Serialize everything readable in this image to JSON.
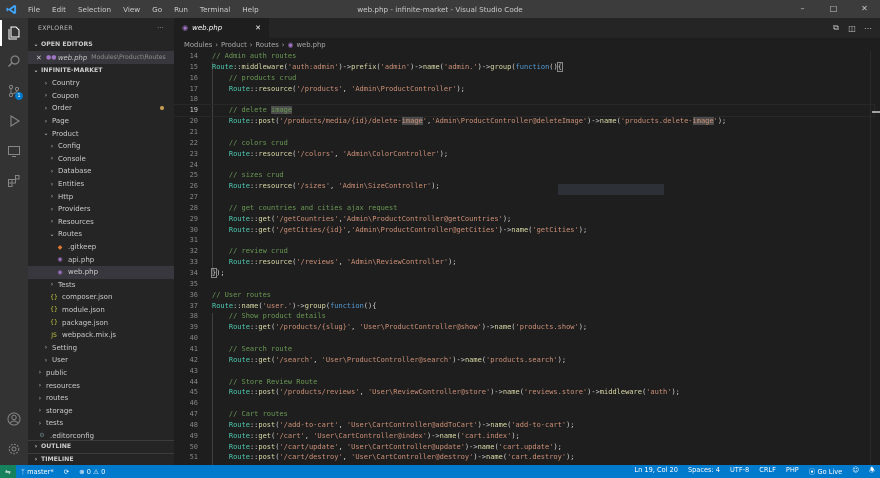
{
  "titlebar": {
    "menu": [
      "File",
      "Edit",
      "Selection",
      "View",
      "Go",
      "Run",
      "Terminal",
      "Help"
    ],
    "title": "web.php - infinite-market - Visual Studio Code"
  },
  "sidebar": {
    "header": "EXPLORER",
    "more": "···",
    "open_editors_label": "OPEN EDITORS",
    "open_editor": {
      "name": "web.php",
      "path": "Modules\\Product\\Routes"
    },
    "project_label": "INFINITE-MARKET",
    "tree": [
      {
        "label": "Country",
        "depth": 1,
        "kind": "folder",
        "open": false
      },
      {
        "label": "Coupon",
        "depth": 1,
        "kind": "folder",
        "open": false
      },
      {
        "label": "Order",
        "depth": 1,
        "kind": "folder",
        "open": false,
        "modified": true
      },
      {
        "label": "Page",
        "depth": 1,
        "kind": "folder",
        "open": false
      },
      {
        "label": "Product",
        "depth": 1,
        "kind": "folder",
        "open": true
      },
      {
        "label": "Config",
        "depth": 2,
        "kind": "folder",
        "open": false
      },
      {
        "label": "Console",
        "depth": 2,
        "kind": "folder",
        "open": false
      },
      {
        "label": "Database",
        "depth": 2,
        "kind": "folder",
        "open": false
      },
      {
        "label": "Entities",
        "depth": 2,
        "kind": "folder",
        "open": false
      },
      {
        "label": "Http",
        "depth": 2,
        "kind": "folder",
        "open": false
      },
      {
        "label": "Providers",
        "depth": 2,
        "kind": "folder",
        "open": false
      },
      {
        "label": "Resources",
        "depth": 2,
        "kind": "folder",
        "open": false
      },
      {
        "label": "Routes",
        "depth": 2,
        "kind": "folder",
        "open": true
      },
      {
        "label": ".gitkeep",
        "depth": 3,
        "kind": "file",
        "icon": "git"
      },
      {
        "label": "api.php",
        "depth": 3,
        "kind": "file",
        "icon": "php"
      },
      {
        "label": "web.php",
        "depth": 3,
        "kind": "file",
        "icon": "php",
        "selected": true
      },
      {
        "label": "Tests",
        "depth": 2,
        "kind": "folder",
        "open": false
      },
      {
        "label": "composer.json",
        "depth": 2,
        "kind": "file",
        "icon": "json"
      },
      {
        "label": "module.json",
        "depth": 2,
        "kind": "file",
        "icon": "json"
      },
      {
        "label": "package.json",
        "depth": 2,
        "kind": "file",
        "icon": "json"
      },
      {
        "label": "webpack.mix.js",
        "depth": 2,
        "kind": "file",
        "icon": "js"
      },
      {
        "label": "Setting",
        "depth": 1,
        "kind": "folder",
        "open": false
      },
      {
        "label": "User",
        "depth": 1,
        "kind": "folder",
        "open": false
      },
      {
        "label": "public",
        "depth": 0,
        "kind": "folder",
        "open": false
      },
      {
        "label": "resources",
        "depth": 0,
        "kind": "folder",
        "open": false
      },
      {
        "label": "routes",
        "depth": 0,
        "kind": "folder",
        "open": false
      },
      {
        "label": "storage",
        "depth": 0,
        "kind": "folder",
        "open": false
      },
      {
        "label": "tests",
        "depth": 0,
        "kind": "folder",
        "open": false
      },
      {
        "label": ".editorconfig",
        "depth": 0,
        "kind": "file",
        "icon": "gear"
      }
    ],
    "outline_label": "OUTLINE",
    "timeline_label": "TIMELINE"
  },
  "editor": {
    "tab_label": "web.php",
    "breadcrumb": [
      "Modules",
      "Product",
      "Routes",
      "web.php"
    ],
    "current_line": 19,
    "lines": [
      {
        "n": 14,
        "html": "<span class=\"c\">// Admin auth routes</span>"
      },
      {
        "n": 15,
        "html": "<span class=\"t\">Route</span><span class=\"p\">::</span><span class=\"f\">middleware</span><span class=\"p\">(</span><span class=\"s\">'auth:admin'</span><span class=\"p\">)-&gt;</span><span class=\"f\">prefix</span><span class=\"p\">(</span><span class=\"s\">'admin'</span><span class=\"p\">)-&gt;</span><span class=\"f\">name</span><span class=\"p\">(</span><span class=\"s\">'admin.'</span><span class=\"p\">)-&gt;</span><span class=\"f\">group</span><span class=\"p\">(</span><span class=\"k\">function</span><span class=\"p\">()</span><span class=\"p hlb\">{</span>"
      },
      {
        "n": 16,
        "html": "    <span class=\"c\">// products crud</span>"
      },
      {
        "n": 17,
        "html": "    <span class=\"t\">Route</span><span class=\"p\">::</span><span class=\"f\">resource</span><span class=\"p\">(</span><span class=\"s\">'/products'</span><span class=\"p\">, </span><span class=\"s\">'Admin\\ProductController'</span><span class=\"p\">);</span>"
      },
      {
        "n": 18,
        "html": ""
      },
      {
        "n": 19,
        "html": "    <span class=\"c\">// delete <span class=\"hl\">image</span></span>"
      },
      {
        "n": 20,
        "html": "    <span class=\"t\">Route</span><span class=\"p\">::</span><span class=\"f\">post</span><span class=\"p\">(</span><span class=\"s\">'/products/media/{id}/delete-<span class=\"hl\">image</span>'</span><span class=\"p\">,</span><span class=\"s\">'Admin\\ProductController@deleteImage'</span><span class=\"p\">)-&gt;</span><span class=\"f\">name</span><span class=\"p\">(</span><span class=\"s\">'products.delete-<span class=\"hl\">image</span>'</span><span class=\"p\">);</span>"
      },
      {
        "n": 21,
        "html": ""
      },
      {
        "n": 22,
        "html": "    <span class=\"c\">// colors crud</span>"
      },
      {
        "n": 23,
        "html": "    <span class=\"t\">Route</span><span class=\"p\">::</span><span class=\"f\">resource</span><span class=\"p\">(</span><span class=\"s\">'/colors'</span><span class=\"p\">, </span><span class=\"s\">'Admin\\ColorController'</span><span class=\"p\">);</span>"
      },
      {
        "n": 24,
        "html": ""
      },
      {
        "n": 25,
        "html": "    <span class=\"c\">// sizes crud</span>"
      },
      {
        "n": 26,
        "html": "    <span class=\"t\">Route</span><span class=\"p\">::</span><span class=\"f\">resource</span><span class=\"p\">(</span><span class=\"s\">'/sizes'</span><span class=\"p\">, </span><span class=\"s\">'Admin\\SizeController'</span><span class=\"p\">);</span>"
      },
      {
        "n": 27,
        "html": ""
      },
      {
        "n": 28,
        "html": "    <span class=\"c\">// get countries and cities ajax request</span>"
      },
      {
        "n": 29,
        "html": "    <span class=\"t\">Route</span><span class=\"p\">::</span><span class=\"f\">get</span><span class=\"p\">(</span><span class=\"s\">'/getCountries'</span><span class=\"p\">,</span><span class=\"s\">'Admin\\ProductController@getCountries'</span><span class=\"p\">);</span>"
      },
      {
        "n": 30,
        "html": "    <span class=\"t\">Route</span><span class=\"p\">::</span><span class=\"f\">get</span><span class=\"p\">(</span><span class=\"s\">'/getCities/{id}'</span><span class=\"p\">,</span><span class=\"s\">'Admin\\ProductController@getCities'</span><span class=\"p\">)-&gt;</span><span class=\"f\">name</span><span class=\"p\">(</span><span class=\"s\">'getCities'</span><span class=\"p\">);</span>"
      },
      {
        "n": 31,
        "html": ""
      },
      {
        "n": 32,
        "html": "    <span class=\"c\">// review crud</span>"
      },
      {
        "n": 33,
        "html": "    <span class=\"t\">Route</span><span class=\"p\">::</span><span class=\"f\">resource</span><span class=\"p\">(</span><span class=\"s\">'/reviews'</span><span class=\"p\">, </span><span class=\"s\">'Admin\\ReviewController'</span><span class=\"p\">);</span>"
      },
      {
        "n": 34,
        "html": "<span class=\"p hlb\">}</span><span class=\"p\">);</span>"
      },
      {
        "n": 35,
        "html": ""
      },
      {
        "n": 36,
        "html": "<span class=\"c\">// User routes</span>"
      },
      {
        "n": 37,
        "html": "<span class=\"t\">Route</span><span class=\"p\">::</span><span class=\"f\">name</span><span class=\"p\">(</span><span class=\"s\">'user.'</span><span class=\"p\">)-&gt;</span><span class=\"f\">group</span><span class=\"p\">(</span><span class=\"k\">function</span><span class=\"p\">(){</span>"
      },
      {
        "n": 38,
        "html": "    <span class=\"c\">// Show product details</span>"
      },
      {
        "n": 39,
        "html": "    <span class=\"t\">Route</span><span class=\"p\">::</span><span class=\"f\">get</span><span class=\"p\">(</span><span class=\"s\">'/products/{slug}'</span><span class=\"p\">, </span><span class=\"s\">'User\\ProductController@show'</span><span class=\"p\">)-&gt;</span><span class=\"f\">name</span><span class=\"p\">(</span><span class=\"s\">'products.show'</span><span class=\"p\">);</span>"
      },
      {
        "n": 40,
        "html": ""
      },
      {
        "n": 41,
        "html": "    <span class=\"c\">// Search route</span>"
      },
      {
        "n": 42,
        "html": "    <span class=\"t\">Route</span><span class=\"p\">::</span><span class=\"f\">get</span><span class=\"p\">(</span><span class=\"s\">'/search'</span><span class=\"p\">, </span><span class=\"s\">'User\\ProductController@search'</span><span class=\"p\">)-&gt;</span><span class=\"f\">name</span><span class=\"p\">(</span><span class=\"s\">'products.search'</span><span class=\"p\">);</span>"
      },
      {
        "n": 43,
        "html": ""
      },
      {
        "n": 44,
        "html": "    <span class=\"c\">// Store Review Route</span>"
      },
      {
        "n": 45,
        "html": "    <span class=\"t\">Route</span><span class=\"p\">::</span><span class=\"f\">post</span><span class=\"p\">(</span><span class=\"s\">'/products/reviews'</span><span class=\"p\">, </span><span class=\"s\">'User\\ReviewController@store'</span><span class=\"p\">)-&gt;</span><span class=\"f\">name</span><span class=\"p\">(</span><span class=\"s\">'reviews.store'</span><span class=\"p\">)-&gt;</span><span class=\"f\">middleware</span><span class=\"p\">(</span><span class=\"s\">'auth'</span><span class=\"p\">);</span>"
      },
      {
        "n": 46,
        "html": ""
      },
      {
        "n": 47,
        "html": "    <span class=\"c\">// Cart routes</span>"
      },
      {
        "n": 48,
        "html": "    <span class=\"t\">Route</span><span class=\"p\">::</span><span class=\"f\">post</span><span class=\"p\">(</span><span class=\"s\">'/add-to-cart'</span><span class=\"p\">, </span><span class=\"s\">'User\\CartController@addToCart'</span><span class=\"p\">)-&gt;</span><span class=\"f\">name</span><span class=\"p\">(</span><span class=\"s\">'add-to-cart'</span><span class=\"p\">);</span>"
      },
      {
        "n": 49,
        "html": "    <span class=\"t\">Route</span><span class=\"p\">::</span><span class=\"f\">get</span><span class=\"p\">(</span><span class=\"s\">'/cart'</span><span class=\"p\">, </span><span class=\"s\">'User\\CartController@index'</span><span class=\"p\">)-&gt;</span><span class=\"f\">name</span><span class=\"p\">(</span><span class=\"s\">'cart.index'</span><span class=\"p\">);</span>"
      },
      {
        "n": 50,
        "html": "    <span class=\"t\">Route</span><span class=\"p\">::</span><span class=\"f\">post</span><span class=\"p\">(</span><span class=\"s\">'/cart/update'</span><span class=\"p\">, </span><span class=\"s\">'User\\CartController@update'</span><span class=\"p\">)-&gt;</span><span class=\"f\">name</span><span class=\"p\">(</span><span class=\"s\">'cart.update'</span><span class=\"p\">);</span>"
      },
      {
        "n": 51,
        "html": "    <span class=\"t\">Route</span><span class=\"p\">::</span><span class=\"f\">post</span><span class=\"p\">(</span><span class=\"s\">'/cart/destroy'</span><span class=\"p\">, </span><span class=\"s\">'User\\CartController@destroy'</span><span class=\"p\">)-&gt;</span><span class=\"f\">name</span><span class=\"p\">(</span><span class=\"s\">'cart.destroy'</span><span class=\"p\">);</span>"
      }
    ]
  },
  "statusbar": {
    "branch": "master*",
    "errors": "0",
    "warnings": "0",
    "position": "Ln 19, Col 20",
    "spaces": "Spaces: 4",
    "encoding": "UTF-8",
    "eol": "CRLF",
    "language": "PHP",
    "golive": "Go Live"
  },
  "colors": {
    "statusbar": "#007acc",
    "activitybar": "#333333",
    "sidebar": "#252526",
    "editor": "#1e1e1e"
  }
}
